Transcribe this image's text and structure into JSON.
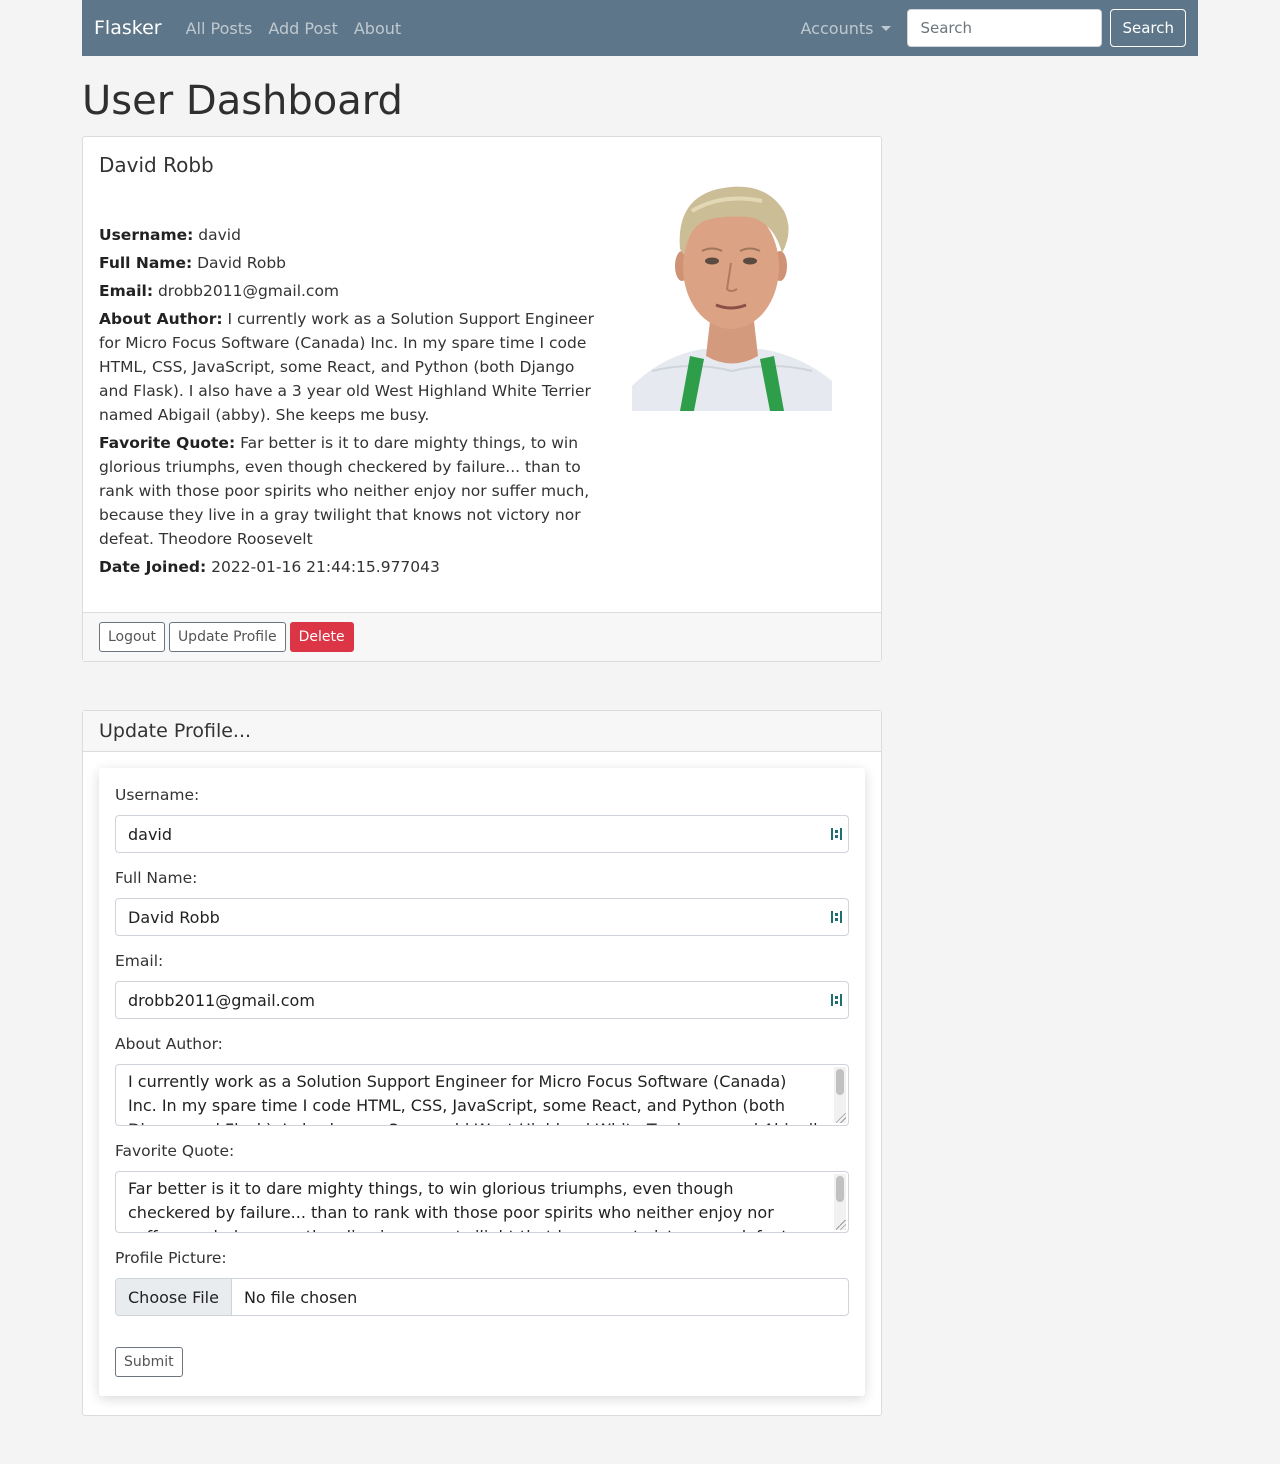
{
  "navbar": {
    "brand": "Flasker",
    "links": [
      "All Posts",
      "Add Post",
      "About"
    ],
    "accounts_label": "Accounts",
    "search_placeholder": "Search",
    "search_button": "Search",
    "background_color": "#5d7689"
  },
  "page_title": "User Dashboard",
  "profile_card": {
    "name": "David Robb",
    "fields": [
      {
        "label": "Username:",
        "value": "david"
      },
      {
        "label": "Full Name:",
        "value": "David Robb"
      },
      {
        "label": "Email:",
        "value": "drobb2011@gmail.com"
      },
      {
        "label": "About Author:",
        "value": "I currently work as a Solution Support Engineer for Micro Focus Software (Canada) Inc. In my spare time I code HTML, CSS, JavaScript, some React, and Python (both Django and Flask). I also have a 3 year old West Highland White Terrier named Abigail (abby). She keeps me busy."
      },
      {
        "label": "Favorite Quote:",
        "value": "Far better is it to dare mighty things, to win glorious triumphs, even though checkered by failure... than to rank with those poor spirits who neither enjoy nor suffer much, because they live in a gray twilight that knows not victory nor defeat. Theodore Roosevelt"
      },
      {
        "label": "Date Joined:",
        "value": "2022-01-16 21:44:15.977043"
      }
    ],
    "buttons": {
      "logout": "Logout",
      "update": "Update Profile",
      "delete": "Delete"
    }
  },
  "update_form": {
    "header": "Update Profile...",
    "username_label": "Username:",
    "username_value": "david",
    "fullname_label": "Full Name:",
    "fullname_value": "David Robb",
    "email_label": "Email:",
    "email_value": "drobb2011@gmail.com",
    "about_label": "About Author:",
    "about_value": "I currently work as a Solution Support Engineer for Micro Focus Software (Canada) Inc. In my spare time I code HTML, CSS, JavaScript, some React, and Python (both Django and Flask). I also have a 3 year old West Highland White Terrier named Abigail (abby). She keeps me busy.",
    "quote_label": "Favorite Quote:",
    "quote_value": "Far better is it to dare mighty things, to win glorious triumphs, even though checkered by failure... than to rank with those poor spirits who neither enjoy nor suffer much, because they live in a gray twilight that knows not victory nor defeat. Theodore Roosevelt",
    "picture_label": "Profile Picture:",
    "choose_file": "Choose File",
    "no_file": "No file chosen",
    "submit": "Submit"
  },
  "colors": {
    "danger": "#dc3545",
    "page_bg": "#f4f4f4"
  }
}
